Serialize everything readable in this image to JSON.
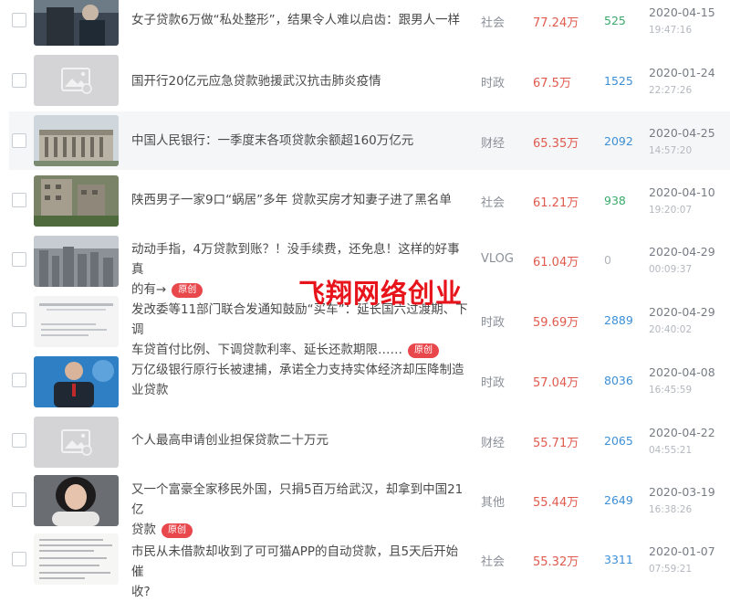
{
  "watermark": "飞翔网络创业",
  "badge_label": "原创",
  "colors": {
    "views": "#e05a4e",
    "count_blue": "#3d8fd6",
    "count_green": "#3aaa6a",
    "count_gray": "#b0b4ba",
    "badge": "#e8474b",
    "watermark": "#e8141b"
  },
  "rows": [
    {
      "title": "女子贷款6万做“私处整形”，结果令人难以启齿：跟男人一样",
      "category": "社会",
      "views": "77.24万",
      "count": "525",
      "count_color": "green",
      "date": "2020-04-15",
      "time": "19:47:16",
      "original": false
    },
    {
      "title": "国开行20亿元应急贷款驰援武汉抗击肺炎疫情",
      "category": "时政",
      "views": "67.5万",
      "count": "1525",
      "count_color": "blue",
      "date": "2020-01-24",
      "time": "22:27:26",
      "original": false
    },
    {
      "title": "中国人民银行：一季度末各项贷款余额超160万亿元",
      "category": "财经",
      "views": "65.35万",
      "count": "2092",
      "count_color": "blue",
      "date": "2020-04-25",
      "time": "14:57:20",
      "original": false
    },
    {
      "title": "陕西男子一家9口“蜗居”多年 贷款买房才知妻子进了黑名单",
      "category": "社会",
      "views": "61.21万",
      "count": "938",
      "count_color": "green",
      "date": "2020-04-10",
      "time": "19:20:07",
      "original": false
    },
    {
      "title_lines": [
        "动动手指，4万贷款到账？！没手续费，还免息！这样的好事真",
        "的有→"
      ],
      "category": "VLOG",
      "views": "61.04万",
      "count": "0",
      "count_color": "gray",
      "date": "2020-04-29",
      "time": "00:09:37",
      "original": true
    },
    {
      "title_lines": [
        "发改委等11部门联合发通知鼓励“买车”：延长国六过渡期、下调",
        "车贷首付比例、下调贷款利率、延长还款期限……"
      ],
      "category": "时政",
      "views": "59.69万",
      "count": "2889",
      "count_color": "blue",
      "date": "2020-04-29",
      "time": "20:40:02",
      "original": true
    },
    {
      "title_lines": [
        "万亿级银行原行长被逮捕，承诺全力支持实体经济却压降制造",
        "业贷款"
      ],
      "category": "时政",
      "views": "57.04万",
      "count": "8036",
      "count_color": "blue",
      "date": "2020-04-08",
      "time": "16:45:59",
      "original": false
    },
    {
      "title": "个人最高申请创业担保贷款二十万元",
      "category": "财经",
      "views": "55.71万",
      "count": "2065",
      "count_color": "blue",
      "date": "2020-04-22",
      "time": "04:55:21",
      "original": false
    },
    {
      "title_lines": [
        "又一个富豪全家移民外国，只捐5百万给武汉，却拿到中国21亿",
        "贷款"
      ],
      "category": "其他",
      "views": "55.44万",
      "count": "2649",
      "count_color": "blue",
      "date": "2020-03-19",
      "time": "16:38:26",
      "original": true
    },
    {
      "title_lines": [
        "市民从未借款却收到了可可猫APP的自动贷款，且5天后开始催",
        "收?"
      ],
      "category": "社会",
      "views": "55.32万",
      "count": "3311",
      "count_color": "blue",
      "date": "2020-01-07",
      "time": "07:59:21",
      "original": false
    }
  ]
}
